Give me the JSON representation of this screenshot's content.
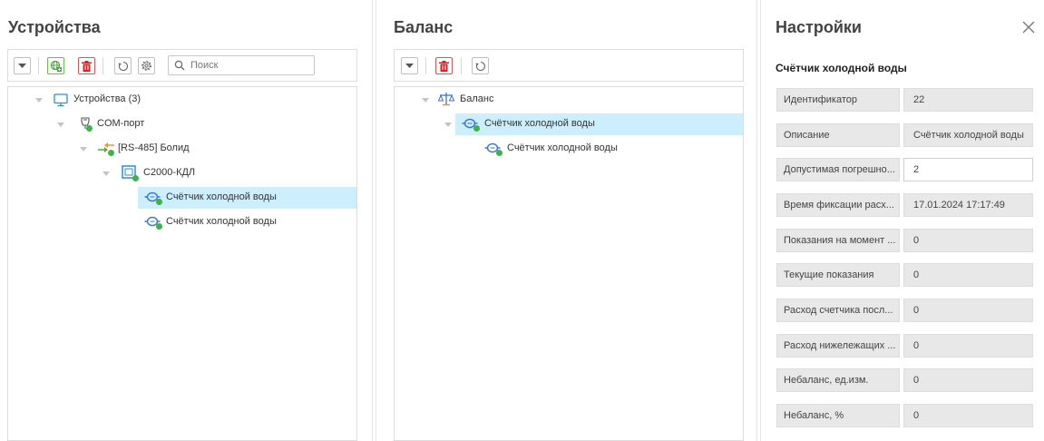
{
  "devices": {
    "title": "Устройства",
    "search_placeholder": "Поиск",
    "tree": [
      "Устройства (3)",
      "COM-порт",
      "[RS-485] Болид",
      "С2000-КДЛ",
      "Счётчик холодной воды",
      "Счётчик холодной воды"
    ]
  },
  "balance": {
    "title": "Баланс",
    "tree": [
      "Баланс",
      "Счётчик холодной воды",
      "Счётчик холодной воды"
    ]
  },
  "settings": {
    "title": "Настройки",
    "subtitle": "Счётчик холодной воды",
    "properties": [
      {
        "label": "Идентификатор",
        "value": "22"
      },
      {
        "label": "Описание",
        "value": "Счётчик холодной воды"
      },
      {
        "label": "Допустимая погрешно...",
        "value": "2"
      },
      {
        "label": "Время фиксации расх...",
        "value": "17.01.2024 17:17:49"
      },
      {
        "label": "Показания на момент ...",
        "value": "0"
      },
      {
        "label": "Текущие показания",
        "value": "0"
      },
      {
        "label": "Расход счетчика посл...",
        "value": "0"
      },
      {
        "label": "Расход нижележащих ...",
        "value": "0"
      },
      {
        "label": "Небаланс, ед.изм.",
        "value": "0"
      },
      {
        "label": "Небаланс, %",
        "value": "0"
      }
    ]
  },
  "colors": {
    "selection": "#cdeefc",
    "online_dot": "#3cb44b",
    "delete_red": "#e05252",
    "add_green": "#6cbf4a"
  },
  "icons": [
    "collapse-icon",
    "add-network-icon",
    "delete-icon",
    "refresh-icon",
    "settings-icon",
    "search-icon",
    "monitor-icon",
    "com-port-icon",
    "rs485-icon",
    "controller-icon",
    "water-meter-icon",
    "scales-icon",
    "close-icon"
  ]
}
